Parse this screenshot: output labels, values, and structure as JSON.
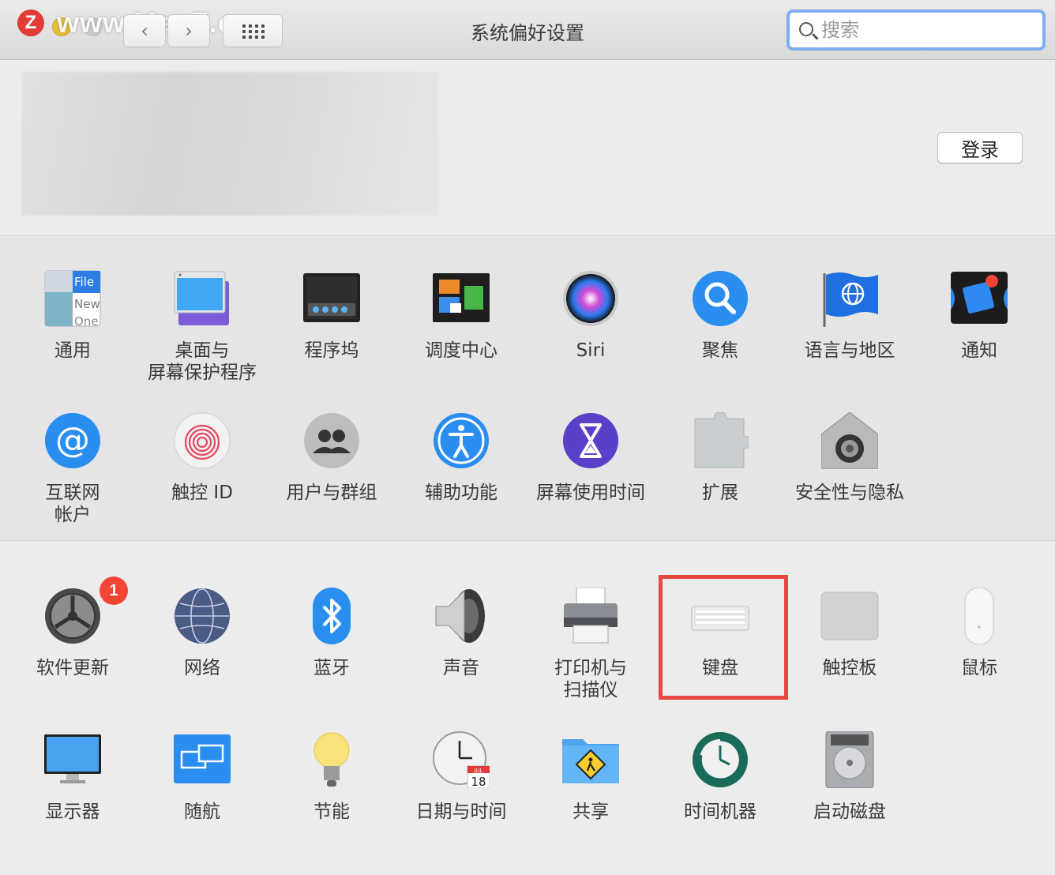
{
  "window": {
    "title": "系统偏好设置"
  },
  "watermark": {
    "badge": "Z",
    "text": "www.MacZ.com"
  },
  "toolbar": {
    "back_glyph": "‹",
    "forward_glyph": "›"
  },
  "search": {
    "placeholder": "搜索",
    "value": ""
  },
  "account": {
    "login_label": "登录"
  },
  "accent": "#e7493f",
  "section1": [
    {
      "id": "general",
      "label": "通用",
      "icon": "general-icon"
    },
    {
      "id": "desktop",
      "label": "桌面与\n屏幕保护程序",
      "icon": "desktop-screensaver-icon"
    },
    {
      "id": "dock",
      "label": "程序坞",
      "icon": "dock-icon"
    },
    {
      "id": "mission",
      "label": "调度中心",
      "icon": "mission-control-icon"
    },
    {
      "id": "siri",
      "label": "Siri",
      "icon": "siri-icon"
    },
    {
      "id": "spotlight",
      "label": "聚焦",
      "icon": "spotlight-icon"
    },
    {
      "id": "language",
      "label": "语言与地区",
      "icon": "language-region-icon"
    },
    {
      "id": "notifications",
      "label": "通知",
      "icon": "notifications-icon"
    },
    {
      "id": "internet",
      "label": "互联网\n帐户",
      "icon": "internet-accounts-icon"
    },
    {
      "id": "touchid",
      "label": "触控 ID",
      "icon": "touch-id-icon"
    },
    {
      "id": "users",
      "label": "用户与群组",
      "icon": "users-groups-icon"
    },
    {
      "id": "accessibility",
      "label": "辅助功能",
      "icon": "accessibility-icon"
    },
    {
      "id": "screentime",
      "label": "屏幕使用时间",
      "icon": "screen-time-icon"
    },
    {
      "id": "extensions",
      "label": "扩展",
      "icon": "extensions-icon"
    },
    {
      "id": "security",
      "label": "安全性与隐私",
      "icon": "security-privacy-icon"
    }
  ],
  "section2": [
    {
      "id": "update",
      "label": "软件更新",
      "icon": "software-update-icon",
      "badge": "1"
    },
    {
      "id": "network",
      "label": "网络",
      "icon": "network-icon"
    },
    {
      "id": "bluetooth",
      "label": "蓝牙",
      "icon": "bluetooth-icon"
    },
    {
      "id": "sound",
      "label": "声音",
      "icon": "sound-icon"
    },
    {
      "id": "printers",
      "label": "打印机与\n扫描仪",
      "icon": "printers-scanners-icon"
    },
    {
      "id": "keyboard",
      "label": "键盘",
      "icon": "keyboard-icon",
      "highlighted": true
    },
    {
      "id": "trackpad",
      "label": "触控板",
      "icon": "trackpad-icon"
    },
    {
      "id": "mouse",
      "label": "鼠标",
      "icon": "mouse-icon"
    },
    {
      "id": "displays",
      "label": "显示器",
      "icon": "displays-icon"
    },
    {
      "id": "sidecar",
      "label": "随航",
      "icon": "sidecar-icon"
    },
    {
      "id": "energy",
      "label": "节能",
      "icon": "energy-saver-icon"
    },
    {
      "id": "datetime",
      "label": "日期与时间",
      "icon": "date-time-icon",
      "calendar_month": "JUL",
      "calendar_day": "18"
    },
    {
      "id": "sharing",
      "label": "共享",
      "icon": "sharing-icon"
    },
    {
      "id": "timemachine",
      "label": "时间机器",
      "icon": "time-machine-icon"
    },
    {
      "id": "startup",
      "label": "启动磁盘",
      "icon": "startup-disk-icon"
    }
  ],
  "general_icon_text": {
    "l1": "File",
    "l2": "New",
    "l3": "One"
  }
}
